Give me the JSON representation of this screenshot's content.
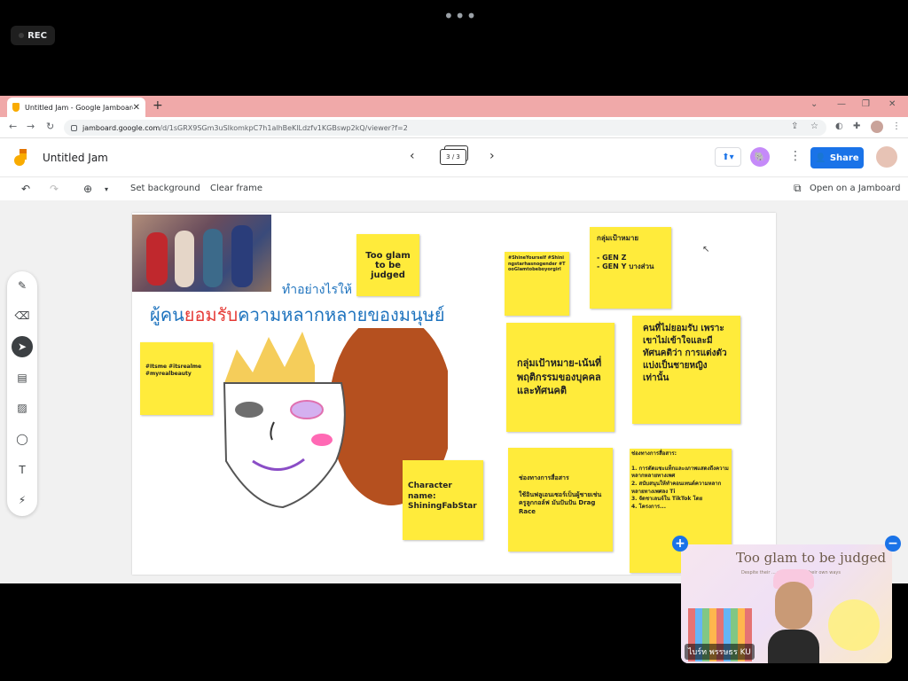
{
  "meeting": {
    "rec_label": "REC",
    "dots": "•••",
    "participant_name": "ไบร์ท พรรษธร KU"
  },
  "browser": {
    "tab_title": "Untitled Jam - Google Jamboard",
    "tab_close": "✕",
    "new_tab": "+",
    "url_host": "jamboard.google.com",
    "url_path": "/d/1sGRX9SGm3uSlkomkpC7h1alhBeKlLdzfv1KGBswp2kQ/viewer?f=2"
  },
  "jamboard": {
    "title": "Untitled Jam",
    "frame_indicator": "3 / 3",
    "share_label": "Share",
    "toolbar": {
      "set_background": "Set background",
      "clear_frame": "Clear frame",
      "open_on_jamboard": "Open on a Jamboard"
    }
  },
  "board": {
    "headline_prefix": "ทำอย่างไรให้",
    "headline_main_1": "ผู้คน",
    "headline_main_red": "ยอมรับ",
    "headline_main_2": "ความหลากหลายของมนุษย์",
    "notes": {
      "too_glam": "Too glam to be judged",
      "hashtags_small": "#ShineYourself #Shiningstarhasnogender #TooGlamtobeboyorgirl",
      "target_group": "กลุ่มเป้าหมาย\n\n- GEN Z\n- GEN Y บางส่วน",
      "itsme": "#Itsme #itsrealme #myrealbeauty",
      "target_focus": "กลุ่มเป้าหมาย-เน้นที่พฤติกรรมของบุคคลและทัศนคติ",
      "non_accept": "คนที่ไม่ยอมรับ เพราะ เขาไม่เข้าใจและมีทัศนคติว่า การแต่งตัวแบ่งเป็นชายหญิงเท่านั้น",
      "character": "Character name: ShiningFabStar",
      "channel": "ช่องทางการสื่อสาร\n\nใช้อินฟลูเอนเซอร์เป็นผู้ชายเช่น ครูลูกกอล์ฟ มันปันปัน Drag Race",
      "channel2_title": "ช่องทางการสื่อสาร:",
      "channel2_body": "1. การตัดแซะแท็กและงภาพแสดงถึงความหลากหลายทางเพศ\n2. สนับสนุนให้ทำคอนเทนต์ความหลากหลายทางเพศลง Ti\n3. จัดชาเลนจ์ใน TikTok โดย\n4. โครงการ..."
    }
  },
  "pip": {
    "bg_text": "Too glam to be judged",
    "sub_text": "Despite their ... regardless in their own ways"
  },
  "colors": {
    "accent": "#1a73e8",
    "note_yellow": "#ffeb3b",
    "headline_blue": "#1e73be",
    "headline_red": "#e53935",
    "tab_bar": "#f0a9a9"
  }
}
